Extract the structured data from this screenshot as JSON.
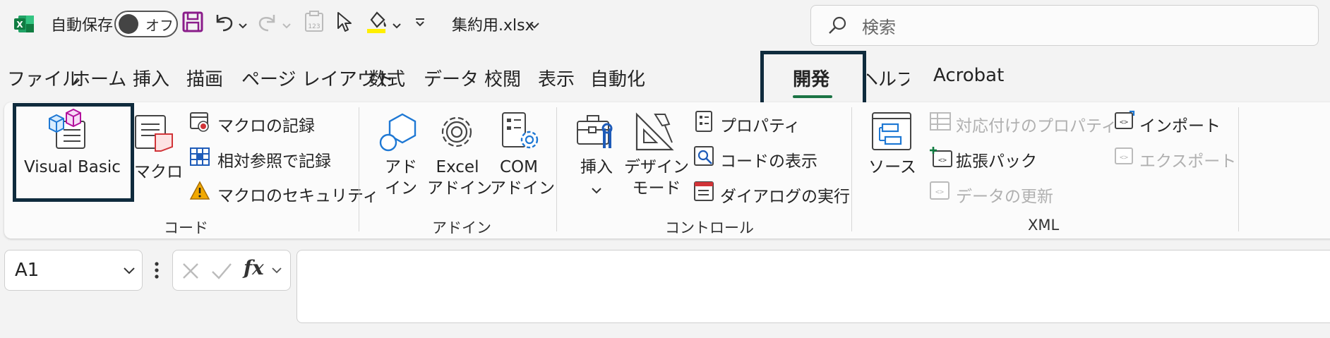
{
  "titlebar": {
    "autosave_label": "自動保存",
    "autosave_state": "オフ",
    "filename": "集約用.xlsx",
    "search_placeholder": "検索"
  },
  "tabs": [
    "ファイル",
    "ホーム",
    "挿入",
    "描画",
    "ページ レイアウト",
    "数式",
    "データ",
    "校閲",
    "表示",
    "自動化",
    "開発",
    "ヘルプ",
    "Acrobat"
  ],
  "active_tab": "開発",
  "ribbon": {
    "code": {
      "group_label": "コード",
      "visual_basic": "Visual Basic",
      "macro": "マクロ",
      "record_macro": "マクロの記録",
      "relative_ref": "相対参照で記録",
      "macro_security": "マクロのセキュリティ"
    },
    "addins": {
      "group_label": "アドイン",
      "addin_1": "アド",
      "addin_2": "イン",
      "excel_1": "Excel",
      "excel_2": "アドイン",
      "com_1": "COM",
      "com_2": "アドイン"
    },
    "controls": {
      "group_label": "コントロール",
      "insert": "挿入",
      "design_1": "デザイン",
      "design_2": "モード",
      "properties": "プロパティ",
      "view_code": "コードの表示",
      "run_dialog": "ダイアログの実行"
    },
    "xml": {
      "group_label": "XML",
      "source": "ソース",
      "map_properties": "対応付けのプロパティ",
      "expansion_packs": "拡張パック",
      "refresh_data": "データの更新",
      "import": "インポート",
      "export": "エクスポート"
    }
  },
  "formula_bar": {
    "cell_ref": "A1",
    "fx": "fx",
    "value": ""
  },
  "colors": {
    "excel_green": "#107c41",
    "save_purple": "#8a1c8a",
    "highlight_box": "#0f2b3d",
    "active_underline": "#1a7343",
    "addin_blue": "#1e78d4",
    "warning": "#f2a900"
  }
}
